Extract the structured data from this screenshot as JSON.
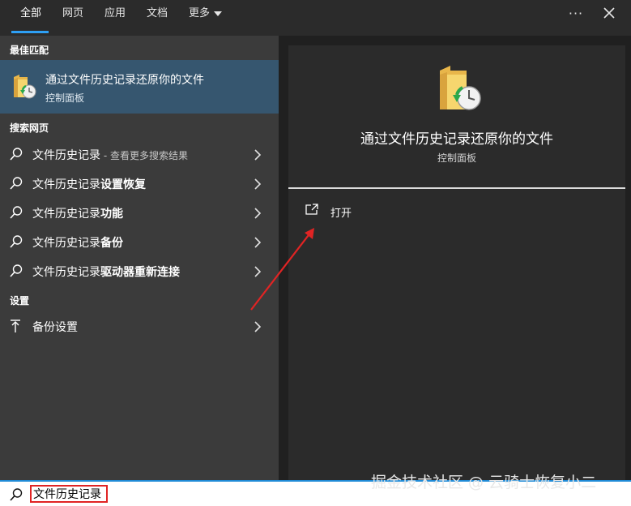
{
  "tabs": [
    {
      "label": "全部",
      "active": true
    },
    {
      "label": "网页"
    },
    {
      "label": "应用"
    },
    {
      "label": "文档"
    },
    {
      "label": "更多"
    }
  ],
  "left": {
    "best_match_heading": "最佳匹配",
    "best_match": {
      "title": "通过文件历史记录还原你的文件",
      "subtitle": "控制面板",
      "icon": "file-history-folder-icon"
    },
    "web_heading": "搜索网页",
    "web_results": [
      {
        "prefix": "文件历史记录",
        "bold": "",
        "suffix": " - 查看更多搜索结果"
      },
      {
        "prefix": "文件历史记录",
        "bold": "设置恢复",
        "suffix": ""
      },
      {
        "prefix": "文件历史记录",
        "bold": "功能",
        "suffix": ""
      },
      {
        "prefix": "文件历史记录",
        "bold": "备份",
        "suffix": ""
      },
      {
        "prefix": "文件历史记录",
        "bold": "驱动器重新连接",
        "suffix": ""
      }
    ],
    "settings_heading": "设置",
    "settings_results": [
      {
        "label": "备份设置",
        "icon": "upload-arrow-icon"
      }
    ]
  },
  "right": {
    "title": "通过文件历史记录还原你的文件",
    "subtitle": "控制面板",
    "open_label": "打开"
  },
  "search": {
    "value": "文件历史记录"
  },
  "watermark": "掘金技术社区 @ 云骑士恢复小二",
  "colors": {
    "accent": "#2ea0f5",
    "selected_bg": "#36566f",
    "left_bg": "#3b3b3b",
    "right_bg": "#2b2b2b",
    "annotation": "#e02424"
  }
}
